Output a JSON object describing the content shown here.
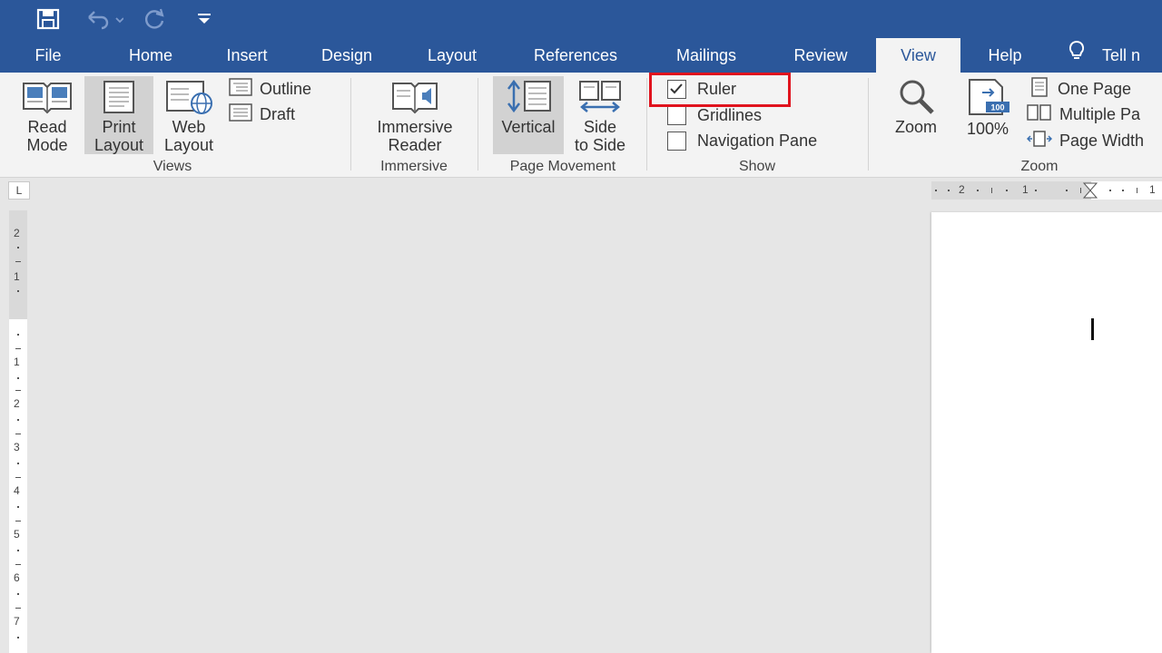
{
  "quick_access": {
    "save_icon": "save-icon",
    "undo_icon": "undo-icon",
    "redo_icon": "redo-icon",
    "customize_icon": "customize-qat-icon"
  },
  "tabs": [
    {
      "label": "File"
    },
    {
      "label": "Home"
    },
    {
      "label": "Insert"
    },
    {
      "label": "Design"
    },
    {
      "label": "Layout"
    },
    {
      "label": "References"
    },
    {
      "label": "Mailings"
    },
    {
      "label": "Review"
    },
    {
      "label": "View",
      "active": true
    },
    {
      "label": "Help"
    },
    {
      "label": "Tell n"
    }
  ],
  "ribbon": {
    "views": {
      "read_mode": [
        "Read",
        "Mode"
      ],
      "print_layout": [
        "Print",
        "Layout"
      ],
      "web_layout": [
        "Web",
        "Layout"
      ],
      "outline": "Outline",
      "draft": "Draft",
      "group_label": "Views"
    },
    "immersive": {
      "reader": [
        "Immersive",
        "Reader"
      ],
      "group_label": "Immersive"
    },
    "page_movement": {
      "vertical": "Vertical",
      "side_to_side": [
        "Side",
        "to Side"
      ],
      "group_label": "Page Movement"
    },
    "show": {
      "ruler": {
        "label": "Ruler",
        "checked": true
      },
      "gridlines": {
        "label": "Gridlines",
        "checked": false
      },
      "navigation_pane": {
        "label": "Navigation Pane",
        "checked": false
      },
      "group_label": "Show"
    },
    "zoom": {
      "zoom": "Zoom",
      "hundred": "100%",
      "hundred_badge": "100",
      "one_page": "One Page",
      "multiple_pages": "Multiple Pa",
      "page_width": "Page Width",
      "group_label": "Zoom"
    }
  },
  "ruler": {
    "tab_selector": "L",
    "horizontal_numbers": [
      "2",
      "1",
      "1"
    ],
    "vertical_numbers": [
      "2",
      "1",
      "1",
      "2",
      "3",
      "4",
      "5",
      "6",
      "7"
    ]
  },
  "colors": {
    "title_blue": "#2b579a",
    "highlight_red": "#e0131d",
    "ribbon_bg": "#f3f3f3",
    "workspace_bg": "#e6e6e6"
  }
}
